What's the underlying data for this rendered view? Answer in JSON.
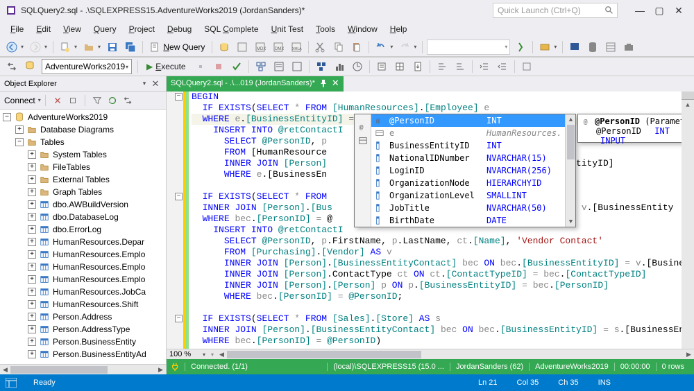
{
  "title": "SQLQuery2.sql - .\\SQLEXPRESS15.AdventureWorks2019 (JordanSanders)*",
  "quick_launch_placeholder": "Quick Launch (Ctrl+Q)",
  "menu": [
    "File",
    "Edit",
    "View",
    "Query",
    "Project",
    "Debug",
    "SQL Complete",
    "Unit Test",
    "Tools",
    "Window",
    "Help"
  ],
  "new_query": "New Query",
  "db_combo": "AdventureWorks2019",
  "execute": "Execute",
  "object_explorer": {
    "title": "Object Explorer",
    "connect": "Connect",
    "root": "AdventureWorks2019",
    "items": [
      {
        "depth": 0,
        "exp": "-",
        "icon": "db",
        "label": "AdventureWorks2019"
      },
      {
        "depth": 1,
        "exp": "+",
        "icon": "folder",
        "label": "Database Diagrams"
      },
      {
        "depth": 1,
        "exp": "-",
        "icon": "folder",
        "label": "Tables"
      },
      {
        "depth": 2,
        "exp": "+",
        "icon": "folder",
        "label": "System Tables"
      },
      {
        "depth": 2,
        "exp": "+",
        "icon": "folder",
        "label": "FileTables"
      },
      {
        "depth": 2,
        "exp": "+",
        "icon": "folder",
        "label": "External Tables"
      },
      {
        "depth": 2,
        "exp": "+",
        "icon": "folder",
        "label": "Graph Tables"
      },
      {
        "depth": 2,
        "exp": "+",
        "icon": "table",
        "label": "dbo.AWBuildVersion"
      },
      {
        "depth": 2,
        "exp": "+",
        "icon": "table",
        "label": "dbo.DatabaseLog"
      },
      {
        "depth": 2,
        "exp": "+",
        "icon": "table",
        "label": "dbo.ErrorLog"
      },
      {
        "depth": 2,
        "exp": "+",
        "icon": "table",
        "label": "HumanResources.Depar"
      },
      {
        "depth": 2,
        "exp": "+",
        "icon": "table",
        "label": "HumanResources.Emplo"
      },
      {
        "depth": 2,
        "exp": "+",
        "icon": "table",
        "label": "HumanResources.Emplo"
      },
      {
        "depth": 2,
        "exp": "+",
        "icon": "table",
        "label": "HumanResources.Emplo"
      },
      {
        "depth": 2,
        "exp": "+",
        "icon": "table",
        "label": "HumanResources.JobCa"
      },
      {
        "depth": 2,
        "exp": "+",
        "icon": "table",
        "label": "HumanResources.Shift"
      },
      {
        "depth": 2,
        "exp": "+",
        "icon": "table",
        "label": "Person.Address"
      },
      {
        "depth": 2,
        "exp": "+",
        "icon": "table",
        "label": "Person.AddressType"
      },
      {
        "depth": 2,
        "exp": "+",
        "icon": "table",
        "label": "Person.BusinessEntity"
      },
      {
        "depth": 2,
        "exp": "+",
        "icon": "table",
        "label": "Person.BusinessEntityAd"
      }
    ]
  },
  "doc_tab": "SQLQuery2.sql - .\\...019 (JordanSanders)*",
  "code": [
    "BEGIN",
    "  IF EXISTS(SELECT * FROM [HumanResources].[Employee] e",
    "  WHERE e.[BusinessEntityID] = |",
    "    INSERT INTO @retContactI",
    "      SELECT @PersonID, p",
    "      FROM [HumanResource",
    "      INNER JOIN [Person]                                         essEntityID]",
    "      WHERE e.[BusinessEn",
    "",
    "  IF EXISTS(SELECT * FROM ",
    "  INNER JOIN [Person].[Bus                                         D] = v.[BusinessEntity",
    "  WHERE bec.[PersonID] = @",
    "    INSERT INTO @retContactI",
    "      SELECT @PersonID, p.FirstName, p.LastName, ct.[Name], 'Vendor Contact'",
    "      FROM [Purchasing].[Vendor] AS v",
    "      INNER JOIN [Person].[BusinessEntityContact] bec ON bec.[BusinessEntityID] = v.[BusinessE",
    "      INNER JOIN [Person].ContactType ct ON ct.[ContactTypeID] = bec.[ContactTypeID]",
    "      INNER JOIN [Person].[Person] p ON p.[BusinessEntityID] = bec.[PersonID]",
    "      WHERE bec.[PersonID] = @PersonID;",
    "",
    "  IF EXISTS(SELECT * FROM [Sales].[Store] AS s",
    "  INNER JOIN [Person].[BusinessEntityContact] bec ON bec.[BusinessEntityID] = s.[BusinessEntity",
    "  WHERE bec.[PersonID] = @PersonID)"
  ],
  "intellisense": [
    {
      "icon": "param",
      "name": "@PersonID",
      "type": "INT",
      "sel": true
    },
    {
      "icon": "alias",
      "name": "e",
      "type": "HumanResources.",
      "e": true
    },
    {
      "icon": "col",
      "name": "BusinessEntityID",
      "type": "INT"
    },
    {
      "icon": "col",
      "name": "NationalIDNumber",
      "type": "NVARCHAR(15)"
    },
    {
      "icon": "col",
      "name": "LoginID",
      "type": "NVARCHAR(256)"
    },
    {
      "icon": "col",
      "name": "OrganizationNode",
      "type": "HIERARCHYID"
    },
    {
      "icon": "col",
      "name": "OrganizationLevel",
      "type": "SMALLINT"
    },
    {
      "icon": "col",
      "name": "JobTitle",
      "type": "NVARCHAR(50)"
    },
    {
      "icon": "col",
      "name": "BirthDate",
      "type": "DATE"
    }
  ],
  "param_tip": {
    "name": "@PersonID",
    "kind": "(Parameter)",
    "param": "@PersonID",
    "type": "INT",
    "dir": "INPUT"
  },
  "zoom": "100 %",
  "editor_status": {
    "conn": "Connected. (1/1)",
    "server": "(local)\\SQLEXPRESS15 (15.0 ...",
    "user": "JordanSanders (62)",
    "db": "AdventureWorks2019",
    "time": "00:00:00",
    "rows": "0 rows"
  },
  "app_status": {
    "ready": "Ready",
    "ln": "Ln 21",
    "col": "Col 35",
    "ch": "Ch 35",
    "ins": "INS"
  }
}
